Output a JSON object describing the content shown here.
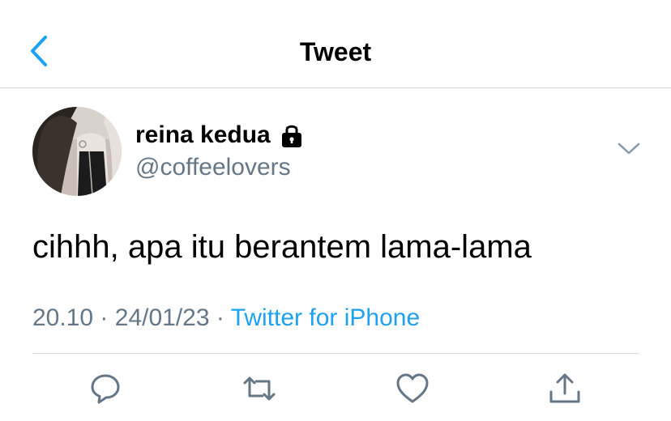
{
  "navbar": {
    "title": "Tweet",
    "back_icon": "chevron-left-icon"
  },
  "author": {
    "display_name": "reina kedua",
    "handle": "@coffeelovers",
    "protected_icon": "lock-icon"
  },
  "tweet": {
    "text": "cihhh, apa itu berantem lama-lama",
    "time": "20.10",
    "separator": "·",
    "date": "24/01/23",
    "source": "Twitter for iPhone"
  },
  "actions": [
    "reply-icon",
    "retweet-icon",
    "like-icon",
    "share-icon"
  ],
  "colors": {
    "accent": "#1da1f2",
    "secondary_text": "#657786",
    "divider": "#d5d8dc",
    "icon": "#657786"
  }
}
